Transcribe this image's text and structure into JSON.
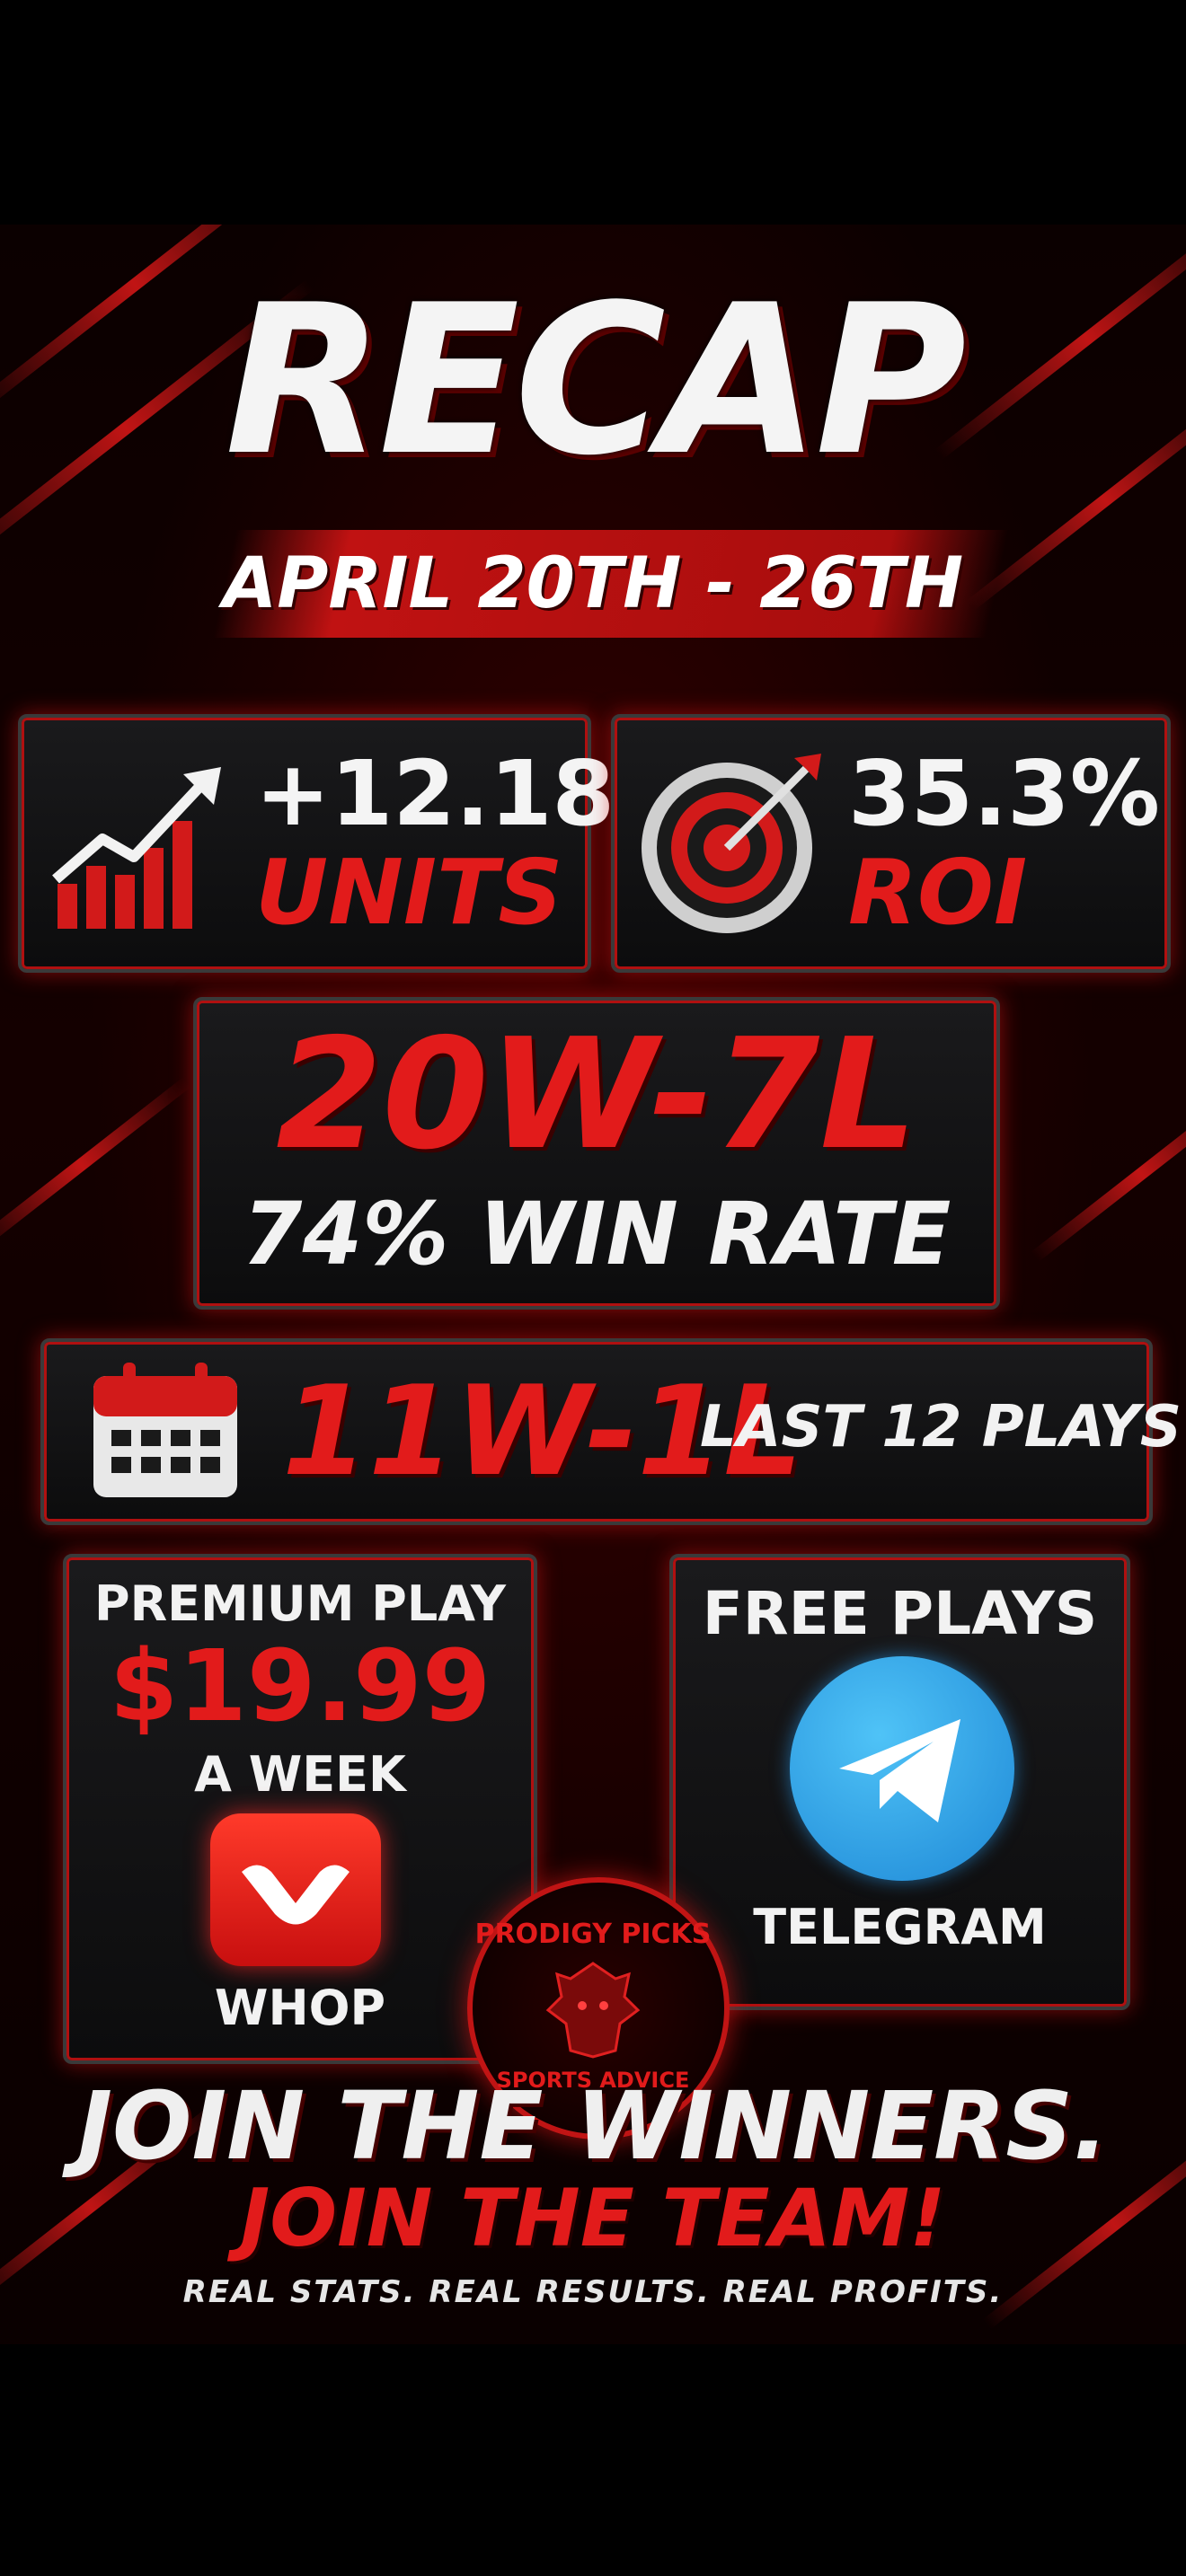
{
  "header": {
    "title": "RECAP",
    "date_range": "APRIL 20TH - 26TH"
  },
  "stats": {
    "units_value": "+12.18",
    "units_label": "UNITS",
    "roi_value": "35.3%",
    "roi_label": "ROI",
    "record": "20W-7L",
    "win_rate": "74% WIN RATE",
    "recent_record": "11W-1L",
    "recent_label": "LAST 12 PLAYS"
  },
  "premium": {
    "label": "PREMIUM PLAY",
    "price": "$19.99",
    "period": "A WEEK",
    "platform": "WHOP"
  },
  "free": {
    "label": "FREE PLAYS",
    "platform": "TELEGRAM"
  },
  "logo": {
    "top_text": "PRODIGY PICKS",
    "bottom_text": "SPORTS ADVICE"
  },
  "footer": {
    "headline": "JOIN THE WINNERS.",
    "subheadline": "JOIN THE TEAM!",
    "tagline": "REAL STATS. REAL RESULTS. REAL PROFITS."
  },
  "colors": {
    "accent": "#e21b1b",
    "background": "#000000",
    "text": "#f2f2f2",
    "telegram": "#2aa3e6"
  },
  "icons": {
    "units": "chart-growth-icon",
    "roi": "target-icon",
    "recent": "calendar-icon",
    "premium": "whop-icon",
    "free": "telegram-icon"
  }
}
